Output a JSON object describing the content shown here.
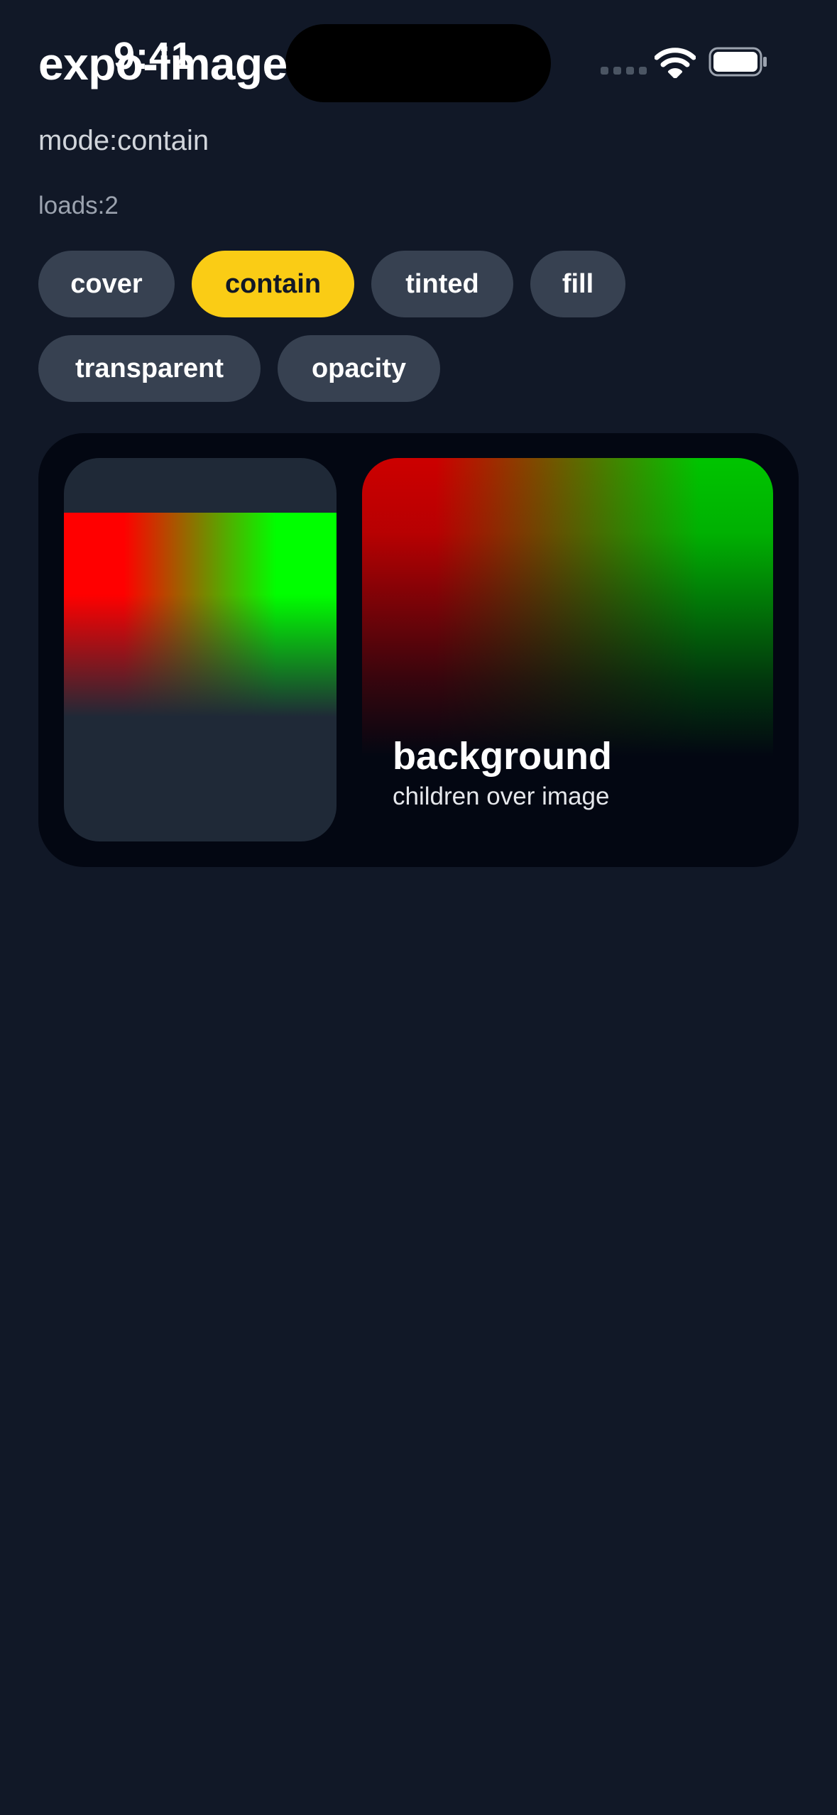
{
  "status_bar": {
    "time": "9:41",
    "icons": [
      "cellular-signal-icon",
      "wifi-icon",
      "battery-icon"
    ]
  },
  "header": {
    "title": "expo-image",
    "mode_text": "mode:contain",
    "loads_text": "loads:2"
  },
  "modes": {
    "selected": "contain",
    "items": [
      {
        "label": "cover",
        "active": false
      },
      {
        "label": "contain",
        "active": true
      },
      {
        "label": "tinted",
        "active": false
      },
      {
        "label": "fill",
        "active": false
      },
      {
        "label": "transparent",
        "active": false
      },
      {
        "label": "opacity",
        "active": false
      }
    ]
  },
  "demo": {
    "background_title": "background",
    "background_subtitle": "children over image"
  },
  "colors": {
    "page_background": "#111827",
    "card_background": "#030712",
    "pill_background": "#374151",
    "pill_active": "#facc15",
    "image_red": "#ff0000",
    "image_green": "#00ff00"
  }
}
